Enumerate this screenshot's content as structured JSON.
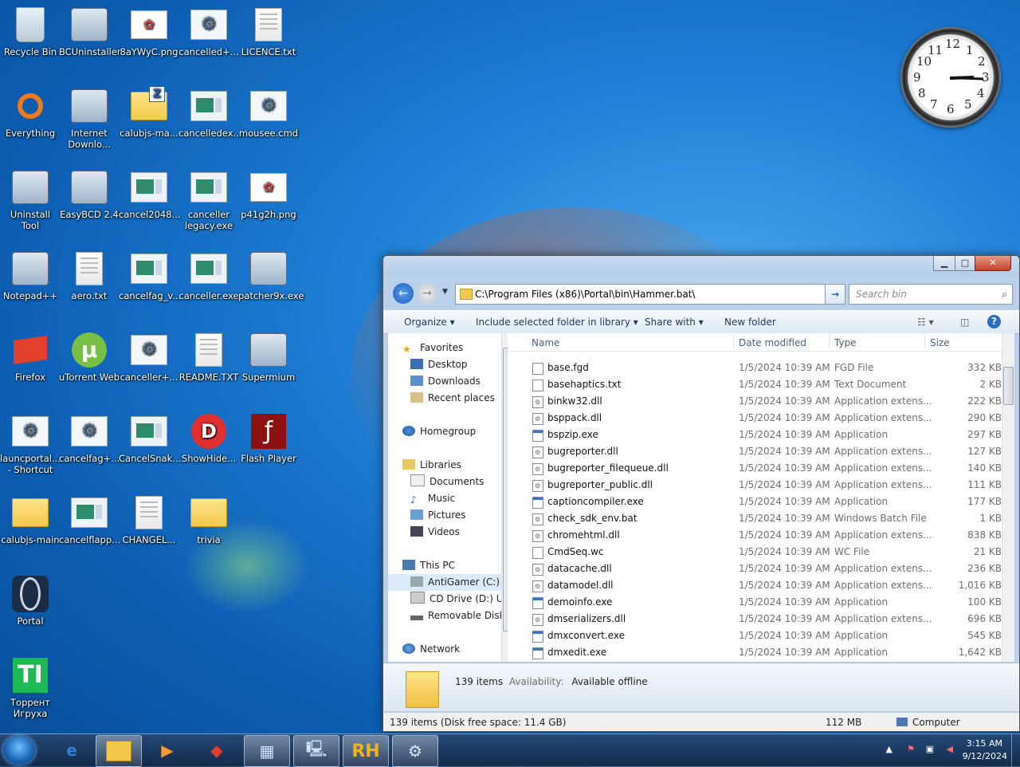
{
  "desktop": {
    "icons": [
      {
        "label": "Recycle Bin",
        "icon": "recycle-bin-icon"
      },
      {
        "label": "BCUninstaller",
        "icon": "bcuninstaller-icon"
      },
      {
        "label": "8aYWyC.png",
        "icon": "image-file-icon"
      },
      {
        "label": "cancelled+...",
        "icon": "gear-file-icon"
      },
      {
        "label": "LICENCE.txt",
        "icon": "text-file-icon"
      },
      {
        "label": "Everything",
        "icon": "everything-icon"
      },
      {
        "label": "Internet Downlo...",
        "icon": "idm-icon"
      },
      {
        "label": "calubjs-ma...",
        "icon": "zip-folder-icon"
      },
      {
        "label": "cancelledex...",
        "icon": "exe-window-icon"
      },
      {
        "label": "mousee.cmd",
        "icon": "gear-file-icon"
      },
      {
        "label": "Uninstall Tool",
        "icon": "uninstall-tool-icon"
      },
      {
        "label": "EasyBCD 2.4",
        "icon": "easybcd-icon"
      },
      {
        "label": "cancel2048...",
        "icon": "exe-window-icon"
      },
      {
        "label": "canceller legacy.exe",
        "icon": "exe-window-icon"
      },
      {
        "label": "p41g2h.png",
        "icon": "image-file-icon"
      },
      {
        "label": "Notepad++",
        "icon": "notepadpp-icon"
      },
      {
        "label": "aero.txt",
        "icon": "text-file-icon"
      },
      {
        "label": "cancelfag_v...",
        "icon": "exe-window-icon"
      },
      {
        "label": "canceller.exe",
        "icon": "exe-window-icon"
      },
      {
        "label": "patcher9x.exe",
        "icon": "patcher-icon"
      },
      {
        "label": "Firefox",
        "icon": "firefox-icon"
      },
      {
        "label": "uTorrent Web",
        "icon": "utorrent-icon"
      },
      {
        "label": "canceller+...",
        "icon": "gear-file-icon"
      },
      {
        "label": "README.TXT",
        "icon": "text-file-icon"
      },
      {
        "label": "Supermium",
        "icon": "supermium-icon"
      },
      {
        "label": "launcportal... - Shortcut",
        "icon": "gear-file-icon"
      },
      {
        "label": "cancelfag+...",
        "icon": "gear-file-icon"
      },
      {
        "label": "CancelSnak...",
        "icon": "exe-window-icon"
      },
      {
        "label": "ShowHide...",
        "icon": "showhide-icon"
      },
      {
        "label": "Flash Player",
        "icon": "flash-player-icon"
      },
      {
        "label": "calubjs-main",
        "icon": "folder-icon"
      },
      {
        "label": "cancelflapp...",
        "icon": "exe-window-icon"
      },
      {
        "label": "CHANGEL...",
        "icon": "text-file-icon"
      },
      {
        "label": "trivia",
        "icon": "folder-icon"
      },
      {
        "label": "Portal",
        "icon": "portal-icon"
      },
      {
        "label": "Торрент Игруха",
        "icon": "torrent-igruha-icon"
      }
    ],
    "clock": {
      "numbers": [
        "12",
        "1",
        "2",
        "3",
        "4",
        "5",
        "6",
        "7",
        "8",
        "9",
        "10",
        "11"
      ]
    }
  },
  "explorer": {
    "address": "C:\\Program Files (x86)\\Portal\\bin\\Hammer.bat\\",
    "search_placeholder": "Search bin",
    "toolbar": {
      "organize": "Organize",
      "include": "Include selected folder in library",
      "share": "Share with",
      "new_folder": "New folder"
    },
    "nav": {
      "favorites": "Favorites",
      "desktop": "Desktop",
      "downloads": "Downloads",
      "recent": "Recent places",
      "homegroup": "Homegroup",
      "libraries": "Libraries",
      "documents": "Documents",
      "music": "Music",
      "pictures": "Pictures",
      "videos": "Videos",
      "this_pc": "This PC",
      "drive_c": "AntiGamer (C:)",
      "drive_d": "CD Drive (D:) Ubu",
      "removable": "Removable Disk (",
      "network": "Network"
    },
    "columns": {
      "name": "Name",
      "date": "Date modified",
      "type": "Type",
      "size": "Size"
    },
    "files": [
      {
        "name": "base.fgd",
        "date": "1/5/2024 10:39 AM",
        "type": "FGD File",
        "size": "332 KB",
        "kind": "file"
      },
      {
        "name": "basehaptics.txt",
        "date": "1/5/2024 10:39 AM",
        "type": "Text Document",
        "size": "2 KB",
        "kind": "file"
      },
      {
        "name": "binkw32.dll",
        "date": "1/5/2024 10:39 AM",
        "type": "Application extens...",
        "size": "222 KB",
        "kind": "dll"
      },
      {
        "name": "bsppack.dll",
        "date": "1/5/2024 10:39 AM",
        "type": "Application extens...",
        "size": "290 KB",
        "kind": "dll"
      },
      {
        "name": "bspzip.exe",
        "date": "1/5/2024 10:39 AM",
        "type": "Application",
        "size": "297 KB",
        "kind": "app"
      },
      {
        "name": "bugreporter.dll",
        "date": "1/5/2024 10:39 AM",
        "type": "Application extens...",
        "size": "127 KB",
        "kind": "dll"
      },
      {
        "name": "bugreporter_filequeue.dll",
        "date": "1/5/2024 10:39 AM",
        "type": "Application extens...",
        "size": "140 KB",
        "kind": "dll"
      },
      {
        "name": "bugreporter_public.dll",
        "date": "1/5/2024 10:39 AM",
        "type": "Application extens...",
        "size": "111 KB",
        "kind": "dll"
      },
      {
        "name": "captioncompiler.exe",
        "date": "1/5/2024 10:39 AM",
        "type": "Application",
        "size": "177 KB",
        "kind": "app"
      },
      {
        "name": "check_sdk_env.bat",
        "date": "1/5/2024 10:39 AM",
        "type": "Windows Batch File",
        "size": "1 KB",
        "kind": "dll"
      },
      {
        "name": "chromehtml.dll",
        "date": "1/5/2024 10:39 AM",
        "type": "Application extens...",
        "size": "838 KB",
        "kind": "dll"
      },
      {
        "name": "CmdSeq.wc",
        "date": "1/5/2024 10:39 AM",
        "type": "WC File",
        "size": "21 KB",
        "kind": "file"
      },
      {
        "name": "datacache.dll",
        "date": "1/5/2024 10:39 AM",
        "type": "Application extens...",
        "size": "236 KB",
        "kind": "dll"
      },
      {
        "name": "datamodel.dll",
        "date": "1/5/2024 10:39 AM",
        "type": "Application extens...",
        "size": "1,016 KB",
        "kind": "dll"
      },
      {
        "name": "demoinfo.exe",
        "date": "1/5/2024 10:39 AM",
        "type": "Application",
        "size": "100 KB",
        "kind": "app"
      },
      {
        "name": "dmserializers.dll",
        "date": "1/5/2024 10:39 AM",
        "type": "Application extens...",
        "size": "696 KB",
        "kind": "dll"
      },
      {
        "name": "dmxconvert.exe",
        "date": "1/5/2024 10:39 AM",
        "type": "Application",
        "size": "545 KB",
        "kind": "app"
      },
      {
        "name": "dmxedit.exe",
        "date": "1/5/2024 10:39 AM",
        "type": "Application",
        "size": "1,642 KB",
        "kind": "app"
      }
    ],
    "details": {
      "count": "139 items",
      "availability_label": "Availability:",
      "availability_value": "Available offline"
    },
    "status": {
      "items": "139 items (Disk free space: 11.4 GB)",
      "size": "112 MB",
      "location": "Computer"
    }
  },
  "taskbar": {
    "apps": [
      "ie-icon",
      "explorer-icon",
      "media-player-icon",
      "firefox-icon",
      "control-panel-icon",
      "computer-icon",
      "rh-icon",
      "steam-icon"
    ],
    "time": "3:15 AM",
    "date": "9/12/2024"
  }
}
